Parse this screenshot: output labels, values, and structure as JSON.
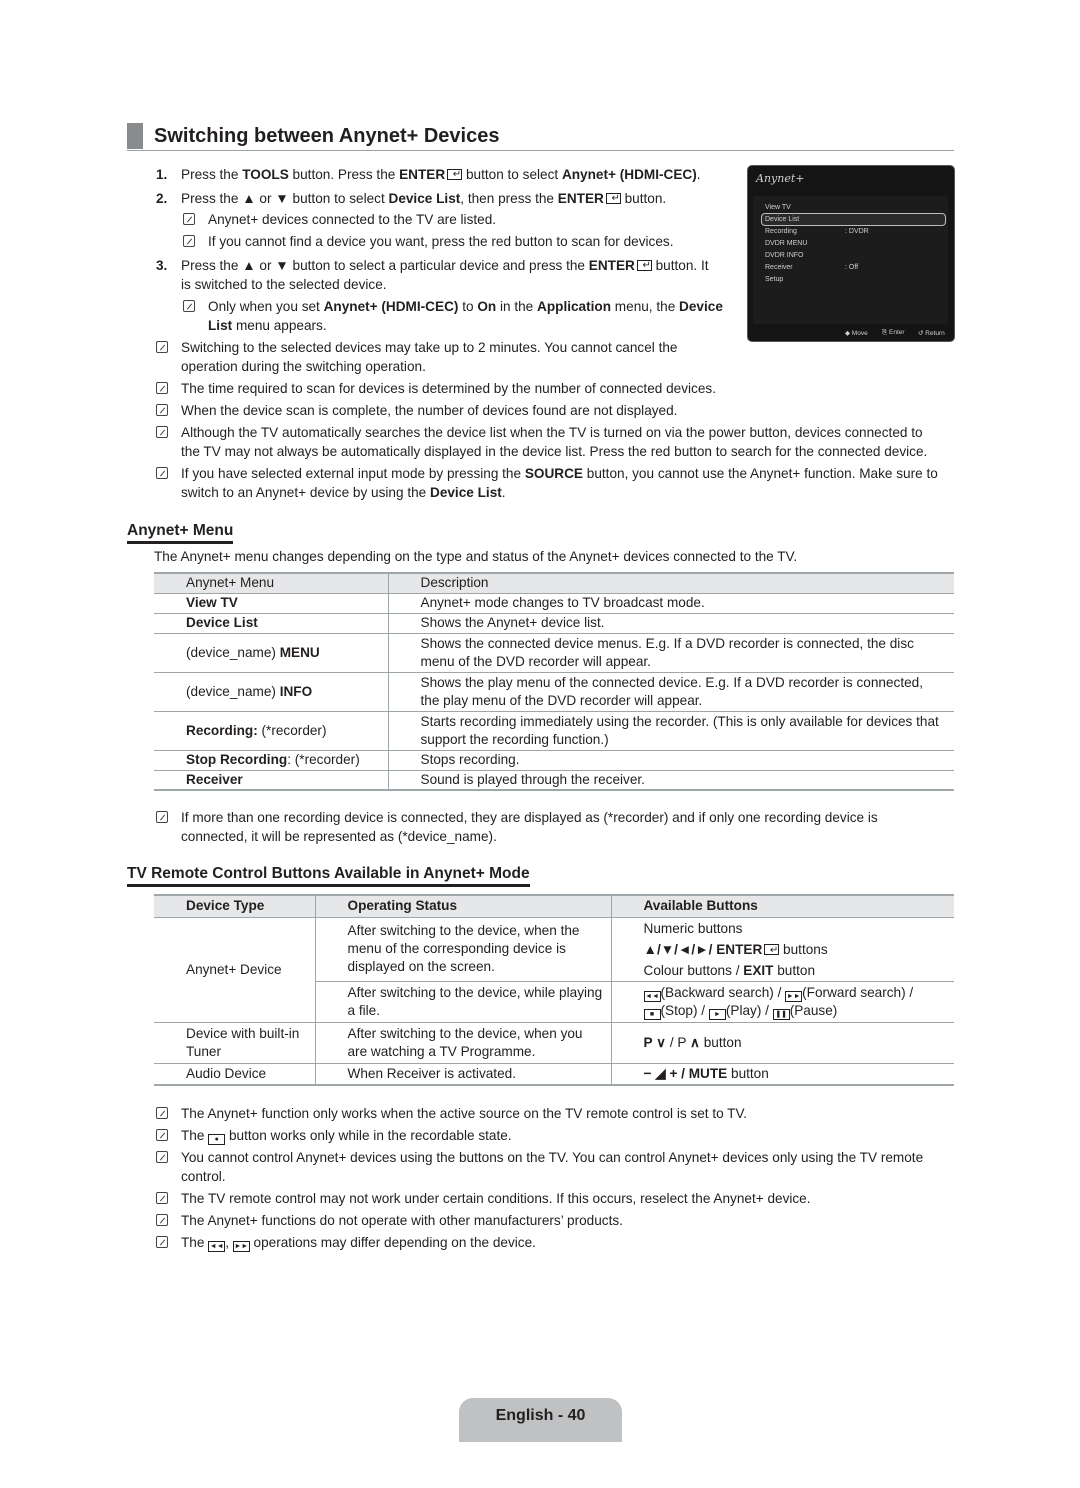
{
  "section": {
    "title": "Switching between Anynet+ Devices",
    "steps": [
      {
        "num": "1.",
        "parts": [
          "Press the ",
          "TOOLS",
          " button. Press the ",
          "ENTER",
          " button to select ",
          "Anynet+ (HDMI-CEC)",
          "."
        ]
      },
      {
        "num": "2.",
        "parts": [
          "Press the ▲ or ▼ button to select ",
          "Device List",
          ", then press the ",
          "ENTER",
          " button."
        ]
      },
      {
        "num": "3.",
        "line1": "Press the ▲ or ▼ button to select a particular device and press the ",
        "bold": "ENTER",
        "line1_end": " button. It",
        "line2": "is switched to the selected device."
      }
    ],
    "step2_notes": [
      "Anynet+ devices connected to the TV are listed.",
      "If you cannot find a device you want, press the red button to scan for devices."
    ],
    "step3_note": {
      "l1a": "Only when you set ",
      "l1b": "Anynet+ (HDMI-CEC)",
      "l1c": " to ",
      "l1d": "On",
      "l1e": " in the ",
      "l1f": "Application",
      "l1g": " menu, the ",
      "l1h": "Device",
      "l2a": "List",
      "l2b": " menu appears."
    },
    "notes": [
      {
        "l1": "Switching to the selected devices may take up to 2 minutes. You cannot cancel the",
        "l2": "operation during the switching operation."
      },
      {
        "l1": "The time required to scan for devices is determined by the number of connected devices."
      },
      {
        "l1": "When the device scan is complete, the number of devices found are not displayed."
      },
      {
        "l1": "Although the TV automatically searches the device list when the TV is turned on via the power button, devices connected to",
        "l2": "the TV may not always be automatically displayed in the device list. Press the red button to search for the connected device."
      },
      {
        "l1a": "If you have selected external input mode by pressing the ",
        "l1b": "SOURCE",
        "l1c": " button, you cannot use the Anynet+ function. Make sure to",
        "l2a": "switch to an Anynet+ device by using the ",
        "l2b": "Device List",
        "l2c": "."
      }
    ]
  },
  "tv_menu": {
    "logo": "Anynet+",
    "items": [
      {
        "label": "View TV",
        "value": ""
      },
      {
        "label": "Device List",
        "value": "",
        "selected": true
      },
      {
        "label": "Recording",
        "value": ": DVDR"
      },
      {
        "label": "DVDR MENU",
        "value": ""
      },
      {
        "label": "DVDR INFO",
        "value": ""
      },
      {
        "label": "Receiver",
        "value": ": Off"
      },
      {
        "label": "Setup",
        "value": ""
      }
    ],
    "footer": {
      "move": "◆ Move",
      "enter": "Enter",
      "return": "Return"
    }
  },
  "anynet_menu": {
    "heading": "Anynet+ Menu",
    "intro": "The Anynet+ menu changes depending on the type and status of the Anynet+ devices connected to the TV.",
    "columns": [
      "Anynet+ Menu",
      "Description"
    ],
    "rows": [
      {
        "menu_bold": "View TV",
        "menu_plain": "",
        "desc1": "Anynet+ mode changes to TV broadcast mode."
      },
      {
        "menu_bold": "Device List",
        "menu_plain": "",
        "desc1": "Shows the Anynet+ device list."
      },
      {
        "menu_plain": "(device_name) ",
        "menu_bold_after": "MENU",
        "desc1": "Shows the connected device menus. E.g. If a DVD recorder is connected, the disc",
        "desc2": "menu of the DVD recorder will appear."
      },
      {
        "menu_plain": "(device_name) ",
        "menu_bold_after": "INFO",
        "desc1": "Shows the play menu of the connected device. E.g. If a DVD recorder is connected,",
        "desc2": "the play menu of the DVD recorder will appear."
      },
      {
        "menu_bold": "Recording:",
        "menu_plain": " (*recorder)",
        "desc1": "Starts recording immediately using the recorder. (This is only available for devices that",
        "desc2": "support the recording function.)"
      },
      {
        "menu_bold": "Stop Recording",
        "menu_plain": ": (*recorder)",
        "desc1": "Stops recording."
      },
      {
        "menu_bold": "Receiver",
        "menu_plain": "",
        "desc1": "Sound is played through the receiver."
      }
    ],
    "note": {
      "l1": "If more than one recording device is connected, they are displayed as (*recorder) and if only one recording device is",
      "l2": "connected, it will be represented as (*device_name)."
    }
  },
  "remote": {
    "heading": "TV Remote Control Buttons Available in Anynet+ Mode",
    "columns": [
      "Device Type",
      "Operating Status",
      "Available Buttons"
    ],
    "rows": [
      {
        "type": "Anynet+ Device",
        "status": [
          "After switching to the device, when the",
          "menu of the corresponding device is",
          "displayed on the screen."
        ],
        "buttons": [
          "Numeric buttons",
          "▲/▼/◄/►/ ENTER buttons",
          "Colour buttons / EXIT button"
        ]
      },
      {
        "status": [
          "After switching to the device, while playing",
          "a file."
        ],
        "buttons": [
          "(Backward search) / (Forward search) /",
          "(Stop) / (Play) / (Pause)"
        ]
      },
      {
        "type": [
          "Device with built-in",
          "Tuner"
        ],
        "status": [
          "After switching to the device, when you",
          "are watching a TV Programme."
        ],
        "buttons": [
          "P ∨ / P ∧ button"
        ]
      },
      {
        "type": "Audio Device",
        "status": [
          "When Receiver is activated."
        ],
        "buttons": [
          "− ◢ + / MUTE button"
        ]
      }
    ],
    "labels": {
      "numeric": "Numeric buttons",
      "arrows": "▲/▼/◄/►/ ",
      "enter": "ENTER",
      "buttons": " buttons",
      "colour": "Colour buttons / ",
      "exit": "EXIT",
      "button": " button",
      "backward": "(Backward search) / ",
      "forward": "(Forward search) /",
      "stop": "(Stop) / ",
      "play": "(Play) / ",
      "pause": "(Pause)",
      "p_down": "P ",
      "p_sep": " / P ",
      "p_end": " button",
      "vol": "− ◢ + / ",
      "mute": "MUTE",
      "mute_end": " button"
    }
  },
  "final_notes": [
    {
      "text": "The Anynet+ function only works when the active source on the TV remote control is set to TV."
    },
    {
      "pre": "The ",
      "icon": "●",
      "post": " button works only while in the recordable state."
    },
    {
      "l1": "You cannot control Anynet+ devices using the buttons on the TV. You can control Anynet+ devices only using the TV remote",
      "l2": "control."
    },
    {
      "text": "The TV remote control may not work under certain conditions. If this occurs, reselect the Anynet+ device."
    },
    {
      "text": "The Anynet+ functions do not operate with other manufacturers’ products."
    },
    {
      "pre": "The ",
      "icon1": "◄◄",
      "mid": ", ",
      "icon2": "►►",
      "post": " operations may differ depending on the device."
    }
  ],
  "footer": {
    "page_label": "English - 40"
  }
}
